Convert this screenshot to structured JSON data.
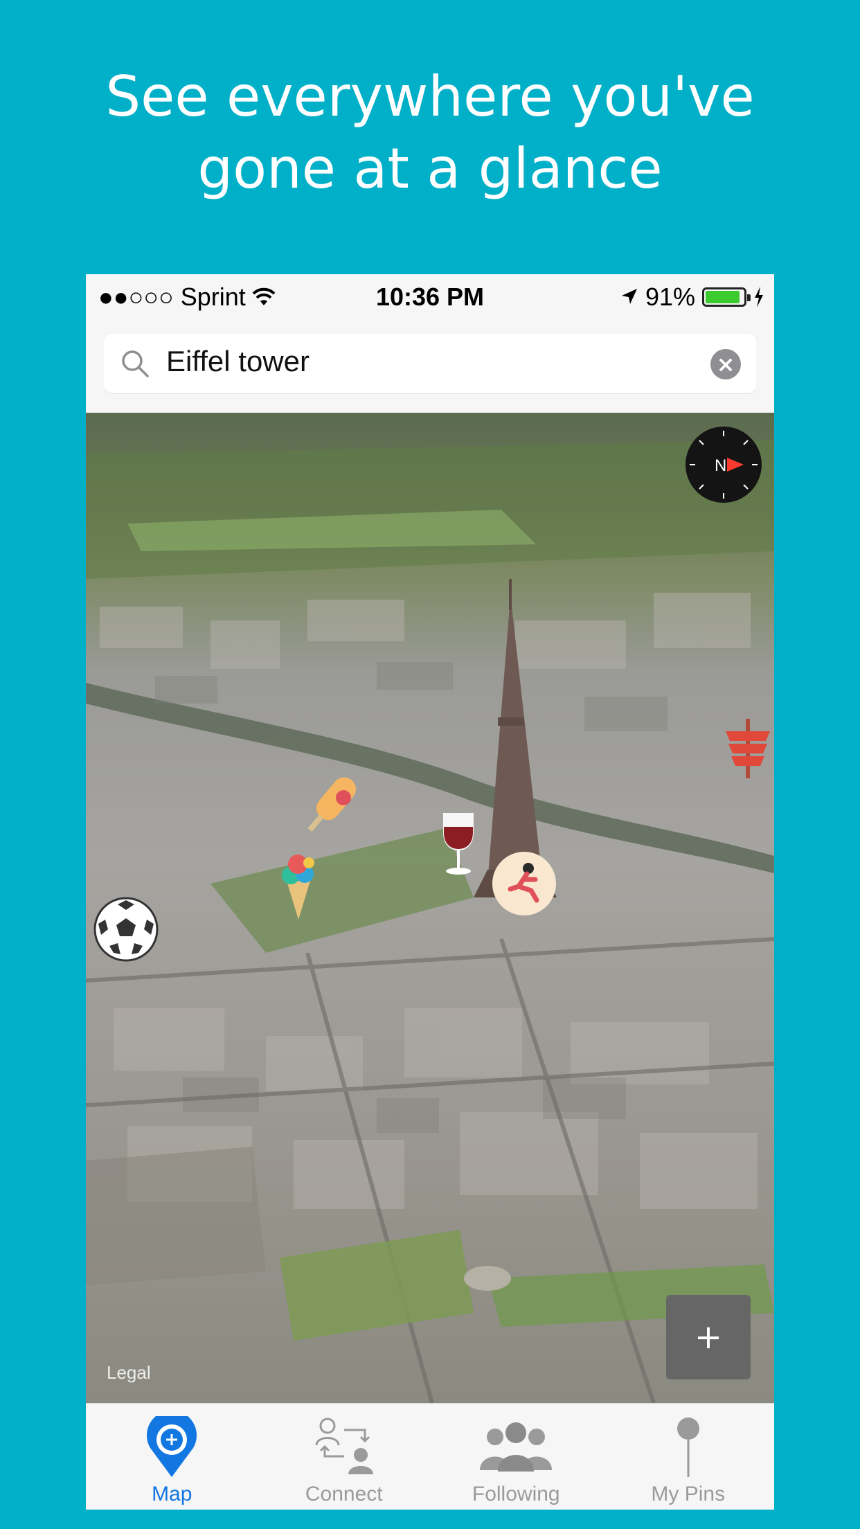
{
  "headline": "See everywhere you've gone at a glance",
  "status_bar": {
    "carrier": "●●○○○ Sprint",
    "time": "10:36 PM",
    "battery_percent": "91%",
    "battery_level": 0.91
  },
  "search": {
    "value": "Eiffel tower",
    "clear_icon": "clear-icon"
  },
  "map": {
    "legal": "Legal",
    "add_label": "+",
    "compass_letter": "N",
    "pins": [
      "ice-cream-icon",
      "wine-icon",
      "runner-icon",
      "soccer-ball-icon",
      "popsicle-icon",
      "kebab-icon"
    ]
  },
  "tabbar": {
    "tabs": [
      {
        "label": "Map",
        "icon": "map-pin-icon",
        "active": true
      },
      {
        "label": "Connect",
        "icon": "connect-icon",
        "active": false
      },
      {
        "label": "Following",
        "icon": "following-icon",
        "active": false
      },
      {
        "label": "My Pins",
        "icon": "pin-icon",
        "active": false
      }
    ]
  },
  "colors": {
    "background": "#00AFC8",
    "accent": "#1277e0",
    "battery": "#3ccb2f"
  }
}
